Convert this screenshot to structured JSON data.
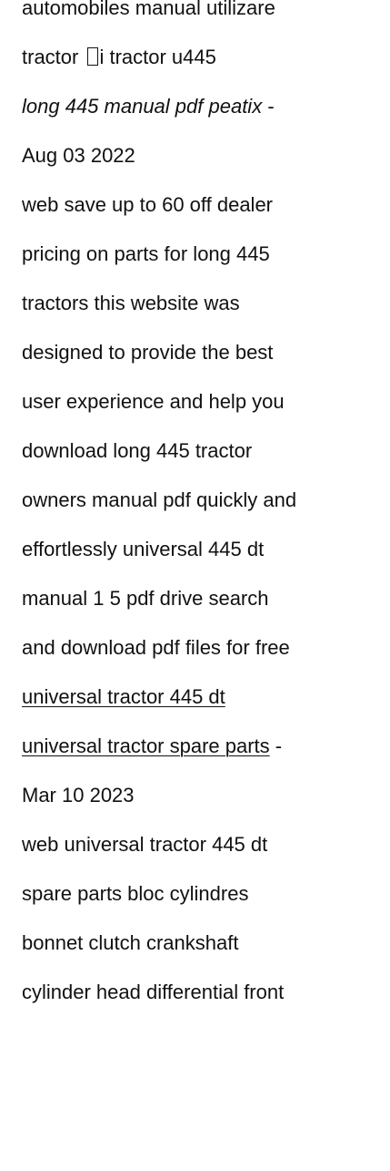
{
  "intro": {
    "line_1": "automobiles manual utilizare",
    "line_2_before_glyph": "tractor ",
    "line_2_after_glyph": "i tractor u445"
  },
  "sections": [
    {
      "title": "long 445 manual pdf peatix",
      "separator": " -",
      "date": "Aug 03 2022",
      "body_lines": [
        "web save up to 60 off dealer",
        "pricing on parts for long 445",
        "tractors this website was",
        "designed to provide the best",
        "user experience and help you",
        "download long 445 tractor",
        "owners manual pdf quickly and",
        "effortlessly universal 445 dt",
        "manual 1 5 pdf drive search",
        "and download pdf files for free"
      ]
    },
    {
      "title_lines": [
        "universal tractor 445 dt",
        "universal tractor spare parts"
      ],
      "separator": " -",
      "date": "Mar 10 2023",
      "body_lines": [
        "web universal tractor 445 dt",
        "spare parts bloc cylindres",
        "bonnet clutch crankshaft",
        "cylinder head differential front"
      ]
    }
  ]
}
